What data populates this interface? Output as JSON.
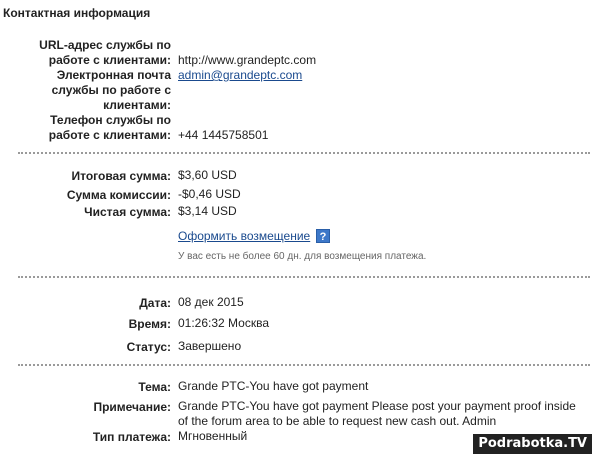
{
  "section_title": "Контактная информация",
  "contact": {
    "url_label": [
      "URL-адрес службы по",
      "работе с клиентами:"
    ],
    "url_value": "http://www.grandeptc.com",
    "email_label": [
      "Электронная почта",
      "службы по работе с",
      "клиентами:"
    ],
    "email_value": "admin@grandeptc.com",
    "phone_label": [
      "Телефон службы по",
      "работе с клиентами:"
    ],
    "phone_value": "+44 1445758501"
  },
  "amounts": {
    "total_label": "Итоговая сумма:",
    "total_value": "$3,60 USD",
    "fee_label": "Сумма комиссии:",
    "fee_value": "-$0,46 USD",
    "net_label": "Чистая сумма:",
    "net_value": "$3,14 USD",
    "refund_link": "Оформить возмещение",
    "help_icon_text": "?",
    "refund_note": "У вас есть не более 60 дн. для возмещения платежа."
  },
  "details": {
    "date_label": "Дата:",
    "date_value": "08 дек 2015",
    "time_label": "Время:",
    "time_value": "01:26:32 Москва",
    "status_label": "Статус:",
    "status_value": "Завершено"
  },
  "message": {
    "subject_label": "Тема:",
    "subject_value": "Grande PTC-You have got payment",
    "note_label": "Примечание:",
    "note_value": [
      "Grande PTC-You have got payment Please post your payment proof inside",
      "of the forum area to be able to request new cash out. Admin"
    ],
    "type_label": "Тип платежа:",
    "type_value": "Мгновенный"
  },
  "watermark": "Podrabotka.TV"
}
